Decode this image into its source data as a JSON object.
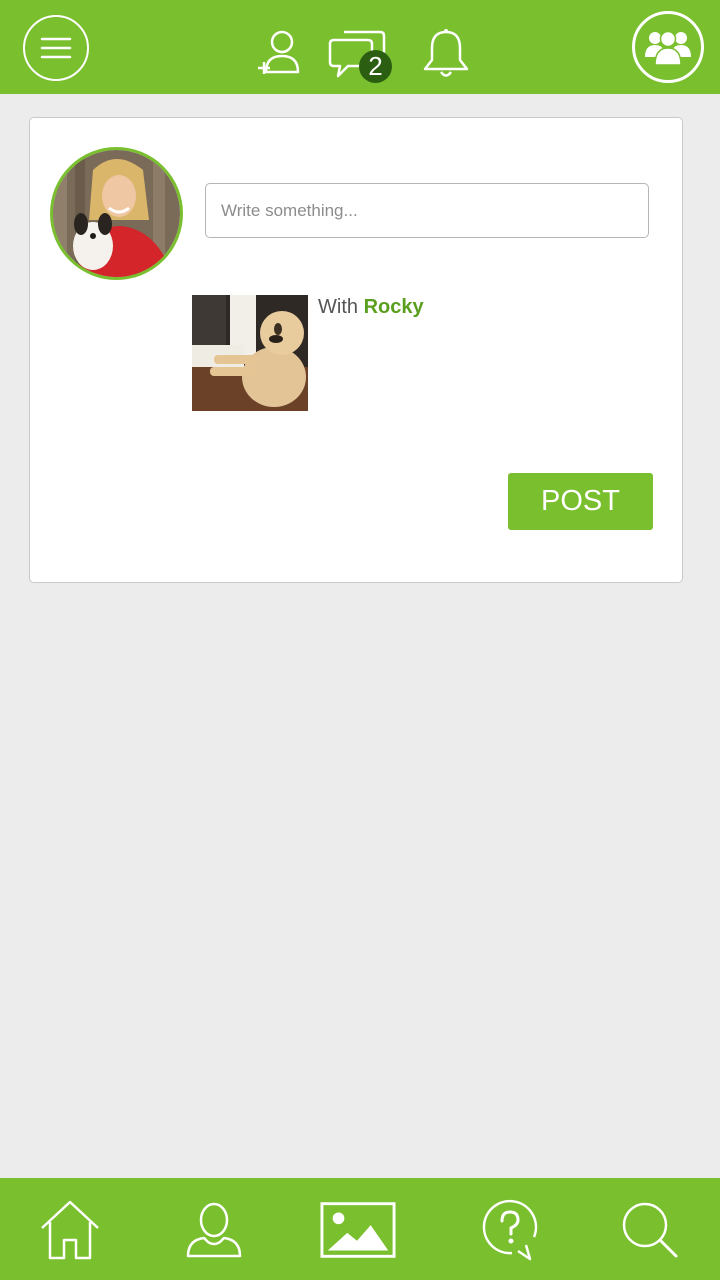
{
  "header": {
    "icons": [
      "menu-icon",
      "add-friend-icon",
      "messages-icon",
      "bell-icon",
      "groups-icon"
    ],
    "messages_badge": "2"
  },
  "composer": {
    "placeholder": "Write something...",
    "with_label": "With",
    "pet_name": "Rocky",
    "post_label": "POST"
  },
  "bottom_nav": {
    "items": [
      "home-icon",
      "profile-icon",
      "photos-icon",
      "help-icon",
      "search-icon"
    ]
  },
  "colors": {
    "brand_green": "#79bf2e",
    "badge_dark_green": "#2c5e12",
    "pet_name_green": "#5a9f1e",
    "background": "#ececec"
  }
}
